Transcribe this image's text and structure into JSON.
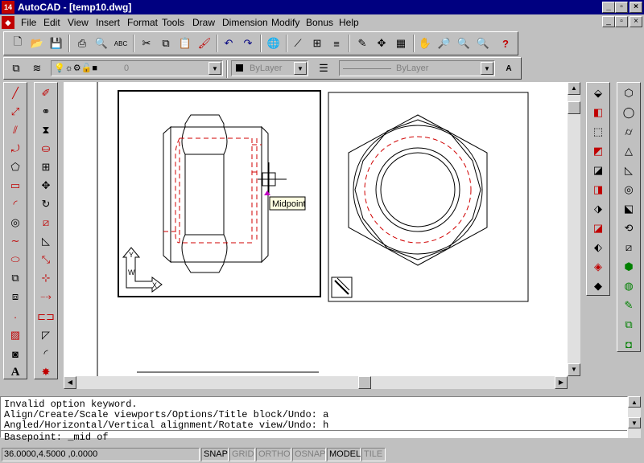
{
  "window": {
    "title": "AutoCAD - [temp10.dwg]",
    "app_icon_text": "14",
    "minimize": "_",
    "restore": "▫",
    "close": "×"
  },
  "menu": {
    "items": [
      "File",
      "Edit",
      "View",
      "Insert",
      "Format",
      "Tools",
      "Draw",
      "Dimension",
      "Modify",
      "Bonus",
      "Help"
    ]
  },
  "layer_bar": {
    "layer_value": "0",
    "color_value": "ByLayer",
    "linetype_value": "ByLayer"
  },
  "drawing": {
    "osnap_tooltip": "Midpoint",
    "ucs_x": "X",
    "ucs_y": "Y",
    "ucs_w": "W",
    "hidden_color": "#d00000"
  },
  "command": {
    "lines": [
      "Invalid option keyword.",
      "Align/Create/Scale viewports/Options/Title block/Undo: a",
      "Angled/Horizontal/Vertical alignment/Rotate view/Undo: h"
    ],
    "prompt": "Basepoint: _mid of"
  },
  "status": {
    "coords": "36.0000,4.5000 ,0.0000",
    "snap": "SNAP",
    "grid": "GRID",
    "ortho": "ORTHO",
    "osnap": "OSNAP",
    "model": "MODEL",
    "tile": "TILE"
  },
  "colors": {
    "titlebar": "#000080",
    "accent_red": "#d00000"
  }
}
